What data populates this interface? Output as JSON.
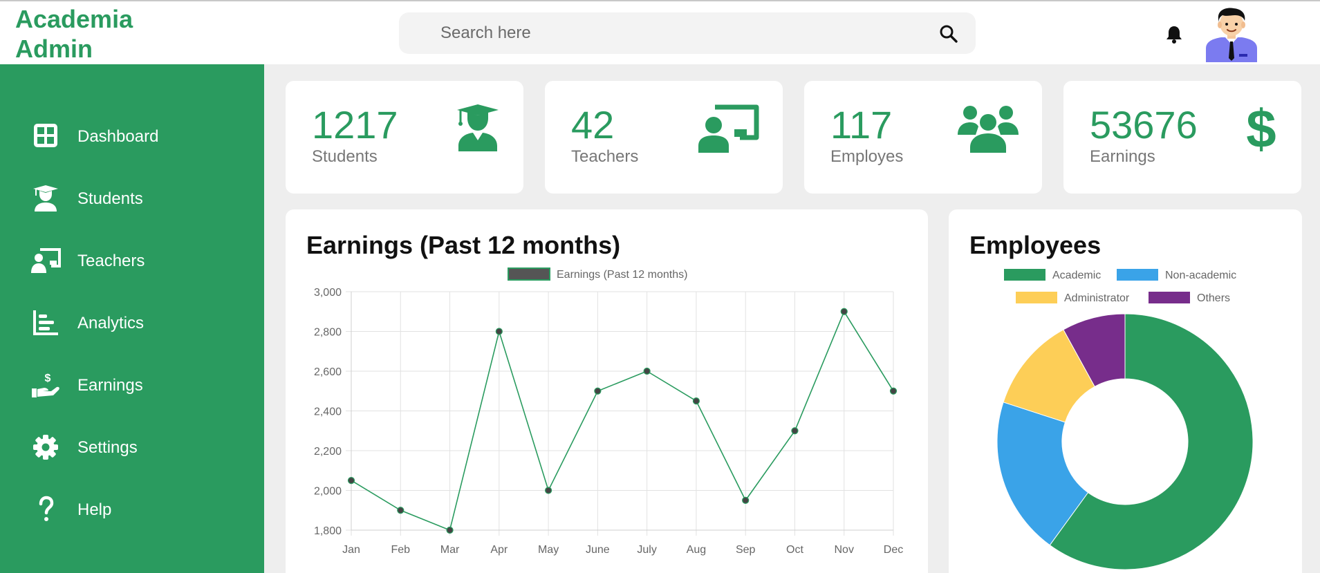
{
  "header": {
    "logo_line1": "Academia",
    "logo_line2": "Admin",
    "search_placeholder": "Search here"
  },
  "sidebar": {
    "items": [
      {
        "label": "Dashboard",
        "icon": "dashboard-icon"
      },
      {
        "label": "Students",
        "icon": "graduate-icon"
      },
      {
        "label": "Teachers",
        "icon": "teacher-icon"
      },
      {
        "label": "Analytics",
        "icon": "analytics-icon"
      },
      {
        "label": "Earnings",
        "icon": "earnings-icon"
      },
      {
        "label": "Settings",
        "icon": "gear-icon"
      },
      {
        "label": "Help",
        "icon": "help-icon"
      }
    ]
  },
  "cards": [
    {
      "value": "1217",
      "label": "Students",
      "icon": "graduate-icon"
    },
    {
      "value": "42",
      "label": "Teachers",
      "icon": "teacher-board-icon"
    },
    {
      "value": "117",
      "label": "Employes",
      "icon": "users-group-icon"
    },
    {
      "value": "53676",
      "label": "Earnings",
      "icon": "dollar-icon"
    }
  ],
  "colors": {
    "brand": "#2a9b5f",
    "academic": "#2a9b5f",
    "non_academic": "#3aa3e8",
    "administrator": "#fdce57",
    "others": "#772d8b"
  },
  "earnings_panel": {
    "title": "Earnings (Past 12 months)"
  },
  "employees_panel": {
    "title": "Employees"
  },
  "chart_data": [
    {
      "type": "line",
      "title": "Earnings (Past 12 months)",
      "legend": "Earnings (Past 12 months)",
      "legend_position": "top",
      "categories": [
        "Jan",
        "Feb",
        "Mar",
        "Apr",
        "May",
        "June",
        "July",
        "Aug",
        "Sep",
        "Oct",
        "Nov",
        "Dec"
      ],
      "series": [
        {
          "name": "Earnings (Past 12 months)",
          "values": [
            2050,
            1900,
            1800,
            2800,
            2000,
            2500,
            2600,
            2450,
            1950,
            2300,
            2900,
            2500
          ]
        }
      ],
      "ylim": [
        1800,
        3000
      ],
      "yticks": [
        1800,
        2000,
        2200,
        2400,
        2600,
        2800,
        3000
      ],
      "ytick_labels": [
        "1,800",
        "2,000",
        "2,200",
        "2,400",
        "2,600",
        "2,800",
        "3,000"
      ],
      "grid": true
    },
    {
      "type": "pie",
      "title": "Employees",
      "legend_position": "top",
      "labels": [
        "Academic",
        "Non-academic",
        "Administrator",
        "Others"
      ],
      "values": [
        60,
        20,
        12,
        8
      ]
    }
  ]
}
